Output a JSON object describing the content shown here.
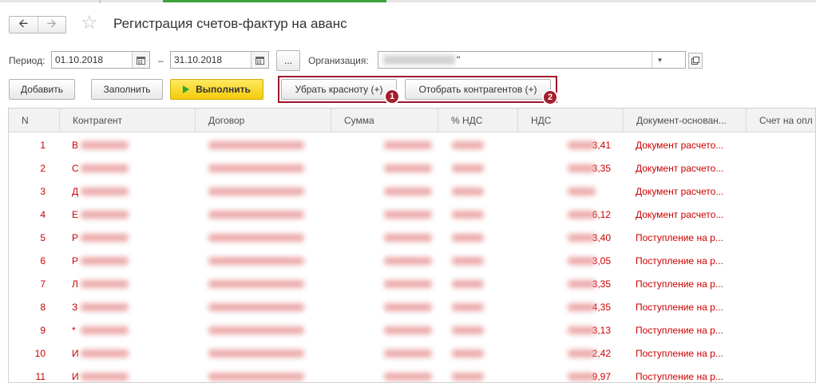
{
  "window": {
    "title": "Регистрация счетов-фактур на аванс"
  },
  "nav": {
    "back_icon": "arrow-left-icon",
    "forward_icon": "arrow-right-icon",
    "favorite_icon": "star-icon"
  },
  "filters": {
    "period_label": "Период:",
    "date_from": "01.10.2018",
    "dash": "–",
    "date_to": "31.10.2018",
    "dots_label": "...",
    "org_label": "Организация:",
    "org_value_suffix": "\""
  },
  "toolbar": {
    "add_label": "Добавить",
    "fill_label": "Заполнить",
    "run_label": "Выполнить",
    "remove_red_label": "Убрать красноту (+)",
    "select_contractors_label": "Отобрать контрагентов (+)",
    "badge1": "1",
    "badge2": "2"
  },
  "table": {
    "headers": [
      "N",
      "Контрагент",
      "Договор",
      "Сумма",
      "% НДС",
      "НДС",
      "Документ-основан...",
      "Счет на опл"
    ],
    "rows": [
      {
        "n": "1",
        "contractor": "В",
        "nds": "3,41",
        "doc": "Документ расчето..."
      },
      {
        "n": "2",
        "contractor": "С",
        "nds": "3,35",
        "doc": "Документ расчето..."
      },
      {
        "n": "3",
        "contractor": "Д",
        "nds": "",
        "doc": "Документ расчето..."
      },
      {
        "n": "4",
        "contractor": "Е",
        "nds": "6,12",
        "doc": "Документ расчето..."
      },
      {
        "n": "5",
        "contractor": "Р",
        "nds": "3,40",
        "doc": "Поступление на р..."
      },
      {
        "n": "6",
        "contractor": "Р",
        "nds": "3,05",
        "doc": "Поступление на р..."
      },
      {
        "n": "7",
        "contractor": "Л",
        "nds": "3,35",
        "doc": "Поступление на р..."
      },
      {
        "n": "8",
        "contractor": "З",
        "nds": "4,35",
        "doc": "Поступление на р..."
      },
      {
        "n": "9",
        "contractor": "*",
        "nds": "3,13",
        "doc": "Поступление на р..."
      },
      {
        "n": "10",
        "contractor": "И",
        "nds": "2,42",
        "doc": "Поступление на р..."
      },
      {
        "n": "11",
        "contractor": "И",
        "nds": "9,97",
        "doc": "Поступление на р..."
      }
    ]
  },
  "colors": {
    "accent_red": "#cc0000",
    "highlight_border": "#a0172b",
    "run_button": "#f4cc0a"
  }
}
